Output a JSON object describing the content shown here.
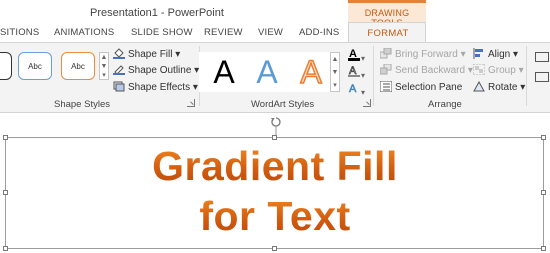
{
  "window": {
    "title": "Presentation1 - PowerPoint"
  },
  "context_tab_group": {
    "label": "DRAWING TOOLS",
    "accent": "#e3823b",
    "text_color": "#c55a11"
  },
  "tabs": [
    {
      "label": "SITIONS"
    },
    {
      "label": "ANIMATIONS"
    },
    {
      "label": "SLIDE SHOW"
    },
    {
      "label": "REVIEW"
    },
    {
      "label": "VIEW"
    },
    {
      "label": "ADD-INS"
    },
    {
      "label": "FORMAT",
      "active": true
    }
  ],
  "ribbon": {
    "shape_styles": {
      "label": "Shape Styles",
      "presets": [
        {
          "label": "Abc"
        },
        {
          "label": "Abc"
        }
      ],
      "commands": {
        "fill": "Shape Fill",
        "outline": "Shape Outline",
        "effects": "Shape Effects"
      }
    },
    "wordart_styles": {
      "label": "WordArt Styles",
      "presets": [
        {
          "letter": "A",
          "style": "black"
        },
        {
          "letter": "A",
          "style": "blue-gradient"
        },
        {
          "letter": "A",
          "style": "orange-outline"
        }
      ]
    },
    "arrange": {
      "label": "Arrange",
      "commands": {
        "bring_forward": "Bring Forward",
        "send_backward": "Send Backward",
        "selection_pane": "Selection Pane",
        "align": "Align",
        "group": "Group",
        "rotate": "Rotate"
      }
    }
  },
  "slide": {
    "text_line1": "Gradient Fill",
    "text_line2": "for Text",
    "text_gradient": [
      "#f08a24",
      "#d35e10",
      "#b9490c"
    ]
  },
  "icons": [
    "paint-bucket-icon",
    "pen-outline-icon",
    "shape-effects-icon",
    "font-color-icon",
    "text-outline-icon",
    "text-effects-icon",
    "bring-forward-icon",
    "send-backward-icon",
    "selection-pane-icon",
    "align-icon",
    "group-icon",
    "rotate-icon",
    "dialog-launcher-icon",
    "rotation-handle-icon"
  ]
}
